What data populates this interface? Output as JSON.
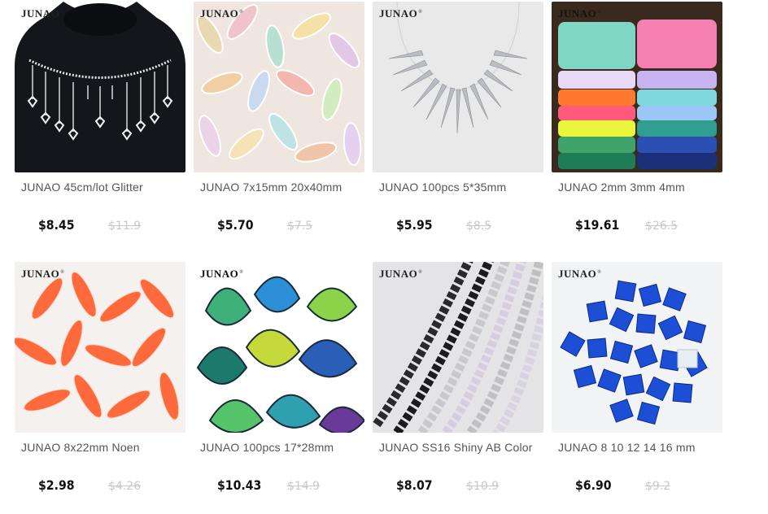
{
  "brand": {
    "name": "JUNAO",
    "mark": "®"
  },
  "products": [
    {
      "title": "JUNAO 45cm/lot Glitter",
      "price": "$8.45",
      "old_price": "$11.9"
    },
    {
      "title": "JUNAO 7x15mm 20x40mm",
      "price": "$5.70",
      "old_price": "$7.5"
    },
    {
      "title": "JUNAO 100pcs 5*35mm",
      "price": "$5.95",
      "old_price": "$8.5"
    },
    {
      "title": "JUNAO 2mm 3mm 4mm",
      "price": "$19.61",
      "old_price": "$26.5"
    },
    {
      "title": "JUNAO 8x22mm Noen",
      "price": "$2.98",
      "old_price": "$4.26"
    },
    {
      "title": "JUNAO 100pcs 17*28mm",
      "price": "$10.43",
      "old_price": "$14.9"
    },
    {
      "title": "JUNAO SS16 Shiny AB Color",
      "price": "$8.07",
      "old_price": "$10.9"
    },
    {
      "title": "JUNAO 8 10 12 14 16 mm",
      "price": "$6.90",
      "old_price": "$9.2"
    }
  ]
}
